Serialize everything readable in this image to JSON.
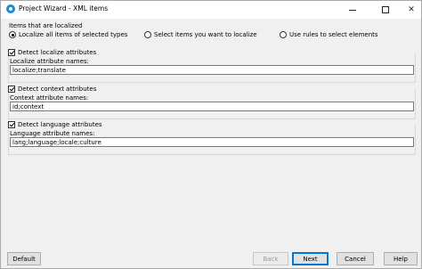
{
  "window": {
    "title": "Project Wizard - XML items"
  },
  "localize_group": {
    "label": "Items that are localized",
    "options": [
      {
        "label": "Localize all items of selected types",
        "selected": true
      },
      {
        "label": "Select items you want to localize",
        "selected": false
      },
      {
        "label": "Use rules to select elements",
        "selected": false
      }
    ]
  },
  "sections": [
    {
      "checkbox_label": "Detect localize attributes",
      "checked": true,
      "field_label": "Localize attribute names:",
      "field_value": "localize;translate"
    },
    {
      "checkbox_label": "Detect context attributes",
      "checked": true,
      "field_label": "Context attribute names:",
      "field_value": "id;context"
    },
    {
      "checkbox_label": "Detect language attributes",
      "checked": true,
      "field_label": "Language attribute names:",
      "field_value": "lang;language;locale;culture"
    }
  ],
  "buttons": {
    "default": "Default",
    "back": "Back",
    "next": "Next",
    "cancel": "Cancel",
    "help": "Help"
  },
  "icons": {
    "app": "app-icon",
    "minimize": "minimize-icon",
    "maximize": "maximize-icon",
    "close": "close-icon"
  },
  "colors": {
    "accent": "#0078d7",
    "app_icon": "#1e88d8"
  }
}
